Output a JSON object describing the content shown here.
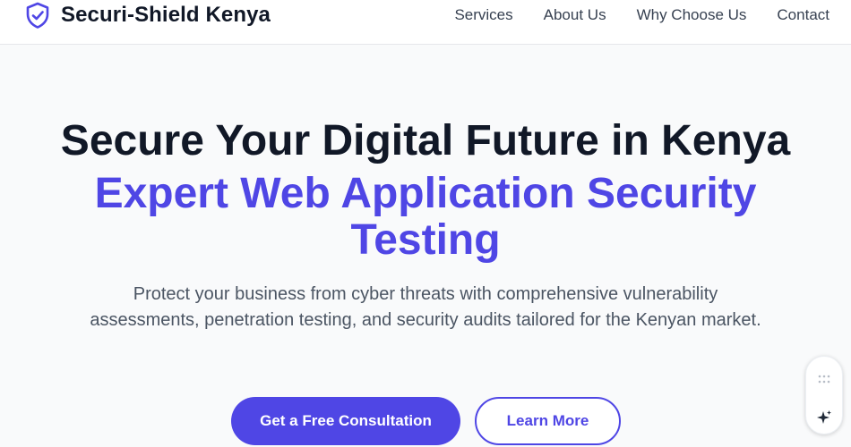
{
  "header": {
    "brand_name": "Securi-Shield Kenya",
    "logo_icon": "shield-check-icon",
    "nav": [
      "Services",
      "About Us",
      "Why Choose Us",
      "Contact"
    ]
  },
  "hero": {
    "title": "Secure Your Digital Future in Kenya",
    "subtitle_line1": "Expert Web Application Security",
    "subtitle_line2": "Testing",
    "description": "Protect your business from cyber threats with comprehensive vulnerability assessments, penetration testing, and security audits tailored for the Kenyan market.",
    "primary_cta": "Get a Free Consultation",
    "secondary_cta": "Learn More"
  },
  "widget": {
    "icons": [
      "drag-grip-icon",
      "sparkle-icon"
    ]
  },
  "colors": {
    "accent": "#4f46e5",
    "heading": "#111827",
    "body_text": "#4b5563",
    "background": "#f9fafb"
  }
}
